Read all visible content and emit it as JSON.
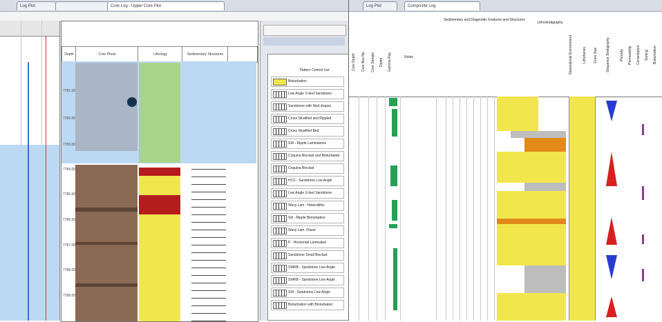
{
  "left_window": {
    "tabs": [
      "Log Plot",
      "",
      "Core Log - Upper Core Plot"
    ],
    "depth_ticks": [
      "7781.00",
      "7782.00",
      "7783.00",
      "7784.00",
      "7785.00",
      "7786.00",
      "7787.00",
      "7788.00",
      "7789.00"
    ],
    "core_header": "Core Photo",
    "lith_header": "Lithology",
    "sed_header": "Sedimentary Structures",
    "depth_header": "Depth",
    "lithology_panel": {
      "title": "Pattern Control List",
      "items": [
        "Bioturbation",
        "Low Angle X-bed Sandstone",
        "Sandstone with Mud drapes",
        "Cross Stratified and Rippled",
        "Cross Stratified Bed",
        "SW - Ripple Laminations",
        "Coquina Bioclast and Bioturbated",
        "Coquina Bioclast",
        "HCS - Sandstone Low Angle",
        "Low Angle X-bed Sandstone",
        "Wavy Lam - Heterolithic",
        "Silt - Ripple Bioturbation",
        "Wavy Lam. Flaser",
        "P - Horizontal Laminated",
        "Sandstone Small Bioclast",
        "SWRB - Sandstone Low Angle",
        "SWRB - Sandstone Low Angle",
        "SW - Sandstone Low Angle",
        "Bioturbation with Bioturbated"
      ]
    }
  },
  "right_window": {
    "tabs": [
      "Log Plot",
      "Composite Log"
    ],
    "title_a": "Sedimentary and Diagenetic Features and Structures",
    "title_b": "Lithostratigraphy",
    "cols_left": [
      "Core Depth",
      "Core Box No",
      "Core Sample",
      "Depth",
      "Gamma Ray",
      "Notes"
    ],
    "cols_right": [
      "Depositional Environment",
      "Lithofacies",
      "Grain Size",
      "Sequence Stratigraphy",
      "Porosity",
      "Permeability",
      "Cementation",
      "Sorting",
      "Bioturbation"
    ]
  },
  "colors": {
    "sand": "#f2e64f",
    "lith_green": "#a8d48b",
    "selection_blue": "#bcd9f3",
    "red_brick": "#b51c1c",
    "gr_green": "#25a055",
    "tri_blue": "#2a3bd1",
    "tri_red": "#d81f1f",
    "orange": "#e18a1a",
    "bio_purple": "#8d3c8a"
  }
}
